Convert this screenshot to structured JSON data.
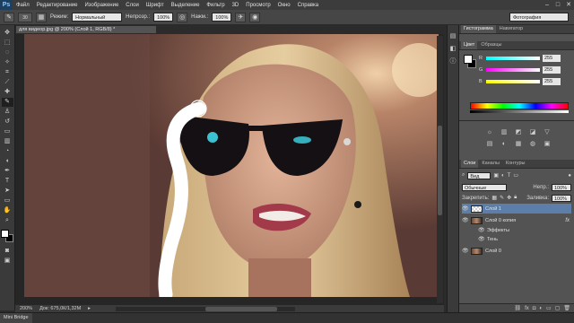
{
  "app": {
    "logo": "Ps"
  },
  "menu": [
    "Файл",
    "Редактирование",
    "Изображение",
    "Слои",
    "Шрифт",
    "Выделение",
    "Фильтр",
    "3D",
    "Просмотр",
    "Окно",
    "Справка"
  ],
  "window_controls": {
    "minimize": "–",
    "maximize": "□",
    "close": "✕"
  },
  "options": {
    "brush_size": "30",
    "mode_label": "Режим:",
    "mode_value": "Нормальный",
    "opacity_label": "Непрозр.:",
    "opacity_value": "100%",
    "flow_label": "Нажм.:",
    "flow_value": "100%",
    "workspace": "Фотография"
  },
  "document": {
    "tab_title": "для видеор.jpg @ 200% (Слой 1, RGB/8) *",
    "zoom": "200%",
    "doc_info": "Док: 675,0К/1,32М"
  },
  "color_panel": {
    "tabs": [
      "Цвет",
      "Образцы"
    ],
    "sliders": [
      {
        "label": "R",
        "value": "255",
        "gradient": "linear-gradient(90deg,#00ffff,#ffffff)"
      },
      {
        "label": "G",
        "value": "255",
        "gradient": "linear-gradient(90deg,#ff00ff,#ffffff)"
      },
      {
        "label": "B",
        "value": "255",
        "gradient": "linear-gradient(90deg,#ffff00,#ffffff)"
      }
    ]
  },
  "top_panel_tabs": [
    "Гистограмма",
    "Навигатор"
  ],
  "adjustments": {
    "icons": [
      "☼",
      "▥",
      "◩",
      "◪",
      "▽",
      "▤",
      "◐",
      "▦",
      "◍",
      "▣"
    ]
  },
  "layers_panel": {
    "tabs": [
      "Слои",
      "Каналы",
      "Контуры"
    ],
    "kind_label": "Вид",
    "blend_mode": "Обычные",
    "opacity_label": "Непр.:",
    "opacity_value": "100%",
    "lock_label": "Закрепить:",
    "fill_label": "Заливка:",
    "fill_value": "100%",
    "layers": [
      {
        "name": "Слой 1",
        "thumb": "transparent",
        "selected": true,
        "fx": ""
      },
      {
        "name": "Слой 0 копия",
        "thumb": "photo",
        "selected": false,
        "fx": "fx"
      },
      {
        "name": "Эффекты",
        "thumb": "none",
        "selected": false,
        "fx": ""
      },
      {
        "name": "Тень",
        "thumb": "none",
        "selected": false,
        "fx": ""
      },
      {
        "name": "Слой 0",
        "thumb": "photo",
        "selected": false,
        "fx": ""
      }
    ]
  },
  "mini_bridge": {
    "label": "Mini Bridge"
  },
  "colors": {
    "foreground": "#ffffff",
    "background": "#000000",
    "selection": "#5d7ea8"
  }
}
